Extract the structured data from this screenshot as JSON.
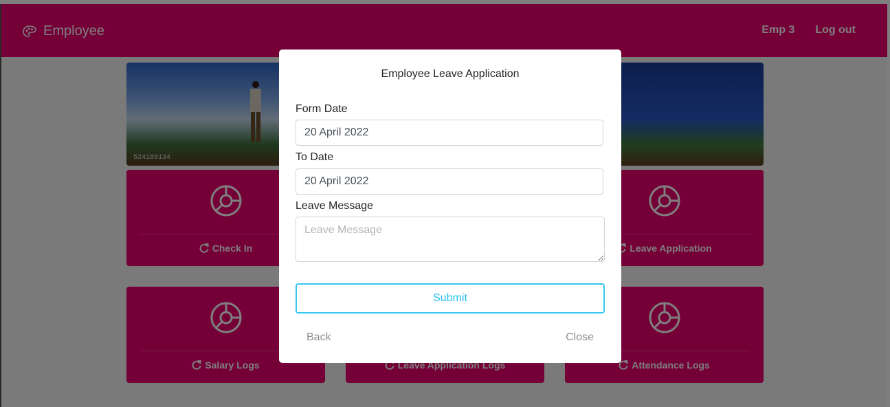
{
  "app": {
    "brand_name": "Employee",
    "brand_icon": "palette-icon",
    "accent_color": "#e8006f"
  },
  "nav": {
    "user": "Emp 3",
    "logout": "Log out"
  },
  "banner": {
    "watermark": "524189134"
  },
  "cards": [
    {
      "label": "Check In",
      "icon": "refresh-icon"
    },
    {
      "label": "Leave Application",
      "icon": "refresh-icon"
    },
    {
      "label": "Salary Logs",
      "icon": "refresh-icon"
    },
    {
      "label": "Leave Application Logs",
      "icon": "refresh-icon"
    },
    {
      "label": "Attendance Logs",
      "icon": "refresh-icon"
    }
  ],
  "modal": {
    "title": "Employee Leave Application",
    "from_date_label": "Form Date",
    "from_date_value": "20 April 2022",
    "to_date_label": "To Date",
    "to_date_value": "20 April 2022",
    "message_label": "Leave Message",
    "message_placeholder": "Leave Message",
    "submit_label": "Submit",
    "back_label": "Back",
    "close_label": "Close",
    "submit_color": "#35c8f2"
  }
}
